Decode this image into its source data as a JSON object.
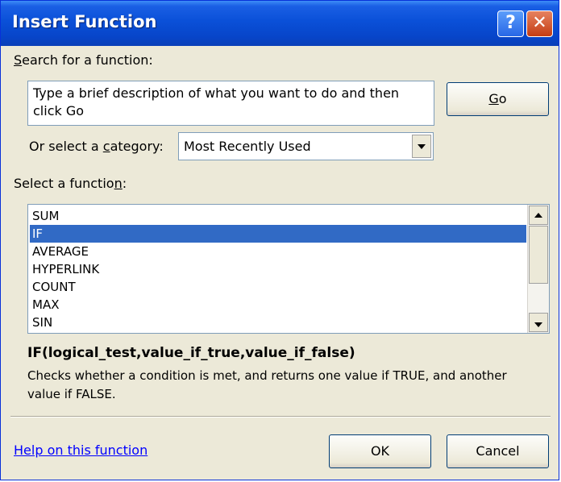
{
  "window": {
    "title": "Insert Function",
    "help_glyph": "?",
    "close_glyph": "✕"
  },
  "search": {
    "label_prefix": "S",
    "label_rest": "earch for a function:",
    "value": "Type a brief description of what you want to do and then click Go",
    "go_button": {
      "accel": "G",
      "rest": "o"
    }
  },
  "category": {
    "label_before": "Or select a ",
    "label_accel": "c",
    "label_after": "ategory:",
    "selected": "Most Recently Used"
  },
  "function_list": {
    "label_before": "Select a functio",
    "label_accel": "n",
    "label_after": ":",
    "items": [
      "SUM",
      "IF",
      "AVERAGE",
      "HYPERLINK",
      "COUNT",
      "MAX",
      "SIN"
    ],
    "selected_index": 1
  },
  "details": {
    "syntax": "IF(logical_test,value_if_true,value_if_false)",
    "description": "Checks whether a condition is met, and returns one value if TRUE, and another value if FALSE."
  },
  "footer": {
    "help_link": "Help on this function",
    "ok_button": "OK",
    "cancel_button": "Cancel"
  },
  "colors": {
    "titlebar": "#0a50d8",
    "selection": "#316ac5",
    "dialog_bg": "#ece9d8",
    "link": "#0000ff"
  }
}
